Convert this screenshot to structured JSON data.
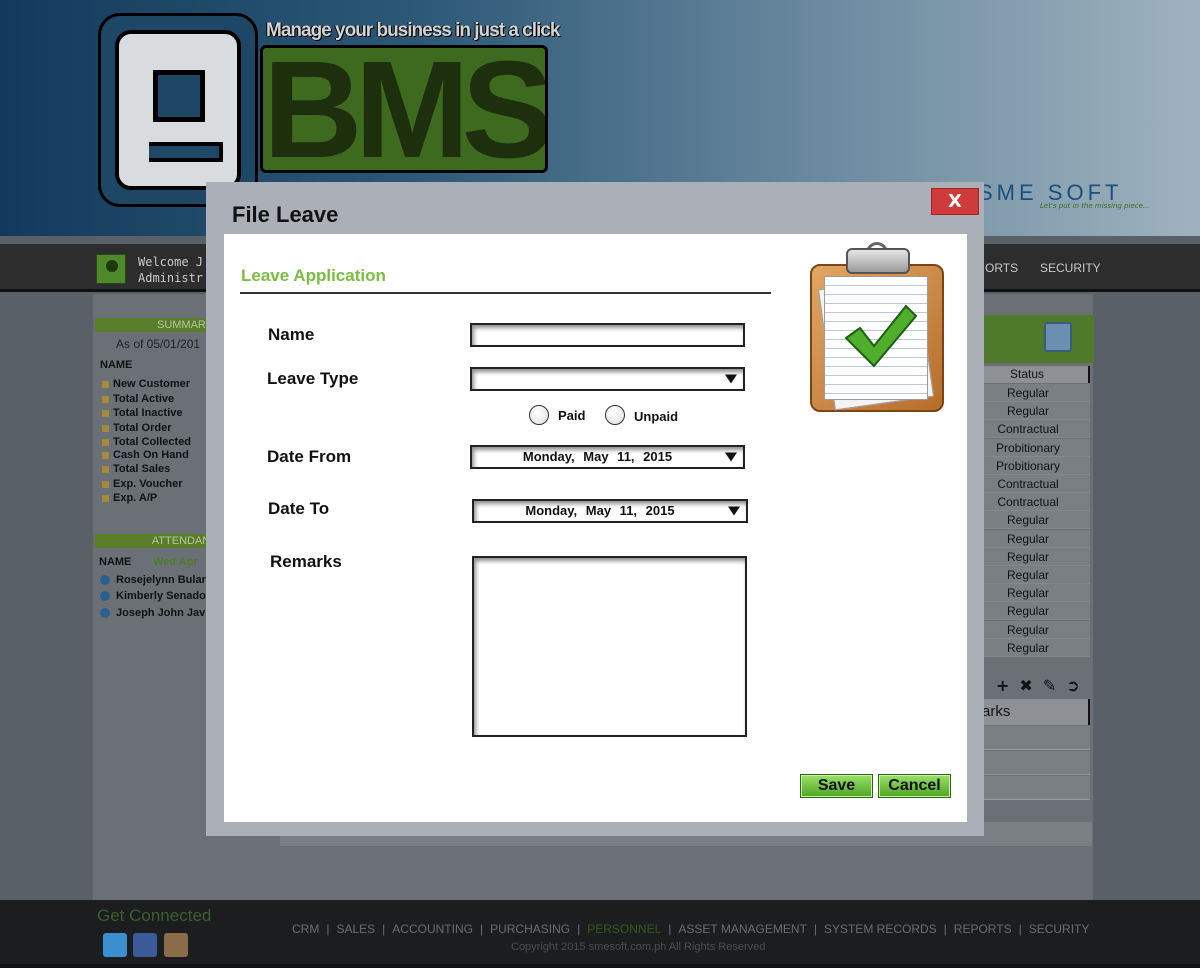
{
  "header": {
    "tagline": "Manage your business in just a click",
    "logo_text": "BMS",
    "company": "SME SOFT",
    "company_tag": "Let's put in the missing piece..."
  },
  "nav": {
    "welcome_line1": "Welcome J",
    "welcome_line2": "Administr",
    "links": [
      "ORTS",
      "SECURITY"
    ]
  },
  "summary": {
    "title": "SUMMARY",
    "as_of": "As of 05/01/201",
    "name_col": "NAME",
    "items": [
      "New Customer",
      "Total Active",
      "Total Inactive",
      "Total Order",
      "Total Collected",
      "Cash On Hand",
      "Total Sales",
      "Exp. Voucher",
      "Exp. A/P"
    ]
  },
  "attendance": {
    "title": "ATTENDANC",
    "name_col": "NAME",
    "date_col": "Wed Apr",
    "people": [
      "Rosejelynn Bular",
      "Kimberly Senado",
      "Joseph John Javi"
    ]
  },
  "grid": {
    "status_header": "Status",
    "statuses": [
      "Regular",
      "Regular",
      "Contractual",
      "Probitionary",
      "Probitionary",
      "Contractual",
      "Contractual",
      "Regular",
      "Regular",
      "Regular",
      "Regular",
      "Regular",
      "Regular",
      "Regular",
      "Regular"
    ],
    "remarks_header": "arks",
    "tool_icons": [
      "plus-icon",
      "delete-icon",
      "edit-icon",
      "next-icon"
    ]
  },
  "modal": {
    "title": "File Leave",
    "close_label": "X",
    "section_title": "Leave Application",
    "name_label": "Name",
    "name_value": "",
    "leave_type_label": "Leave Type",
    "leave_type_value": "",
    "radio_paid": "Paid",
    "radio_unpaid": "Unpaid",
    "date_from_label": "Date From",
    "date_from_value": "Monday,  May  11,  2015",
    "date_to_label": "Date To",
    "date_to_value": "Monday,  May  11,  2015",
    "remarks_label": "Remarks",
    "remarks_value": "",
    "save_label": "Save",
    "cancel_label": "Cancel"
  },
  "footer": {
    "get_connected": "Get Connected",
    "social": [
      "twitter-icon",
      "facebook-icon",
      "instagram-icon"
    ],
    "links": [
      "CRM",
      "SALES",
      "ACCOUNTING",
      "PURCHASING",
      "PERSONNEL",
      "ASSET MANAGEMENT",
      "SYSTEM RECORDS",
      "REPORTS",
      "SECURITY"
    ],
    "active_link": "PERSONNEL",
    "copyright": "Copyright 2015  smesoft.com.ph  All Rights Reserved"
  },
  "colors": {
    "accent_green": "#7bbd3f",
    "close_red": "#cf3a3a",
    "button_green": "#4ea522"
  }
}
